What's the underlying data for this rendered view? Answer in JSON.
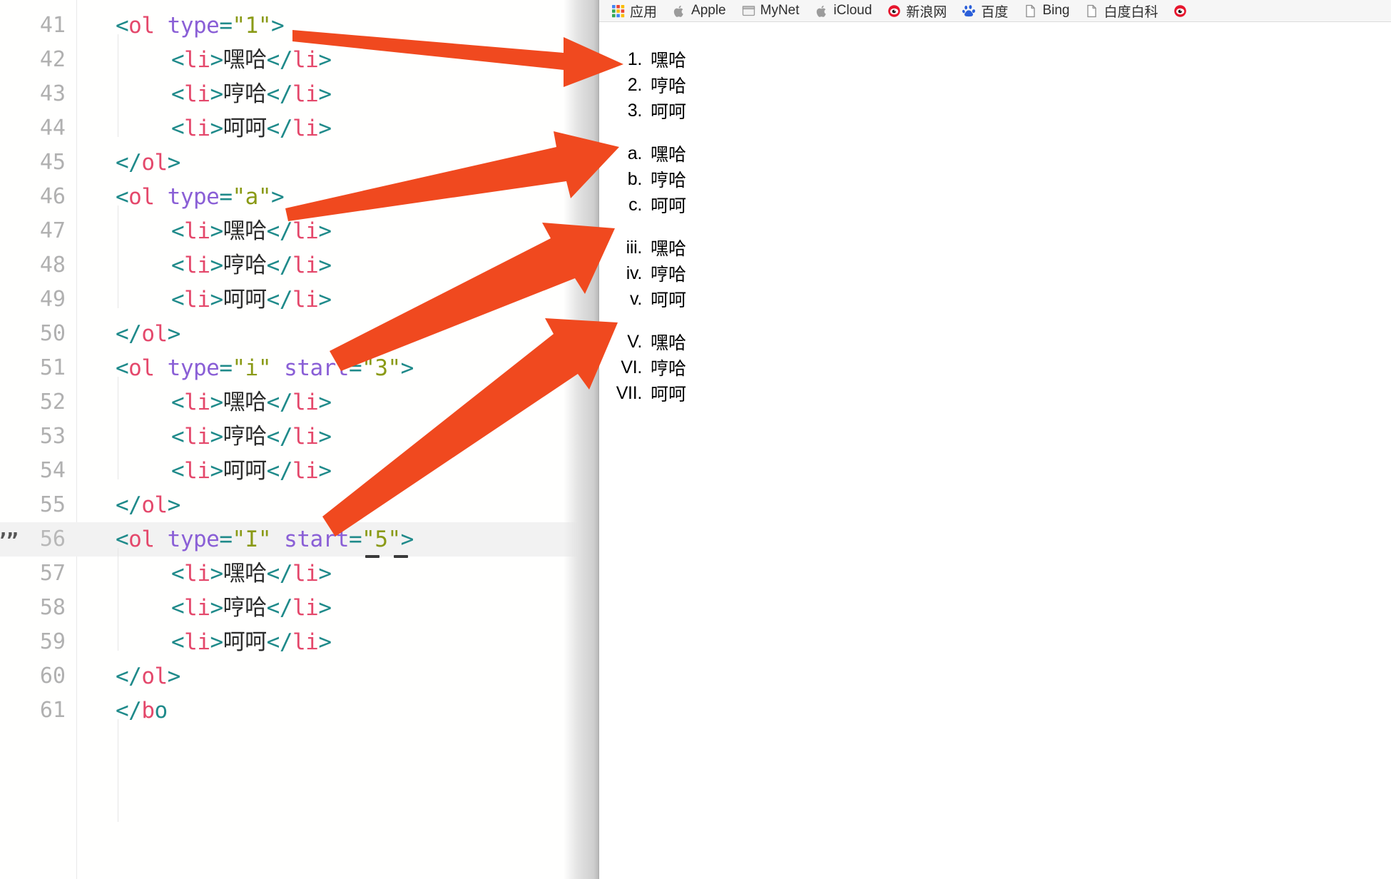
{
  "editor": {
    "language": "html",
    "first_line": 41,
    "highlighted_line": 56,
    "highlight_marker": "””",
    "lines": [
      {
        "n": "41",
        "indent": 1,
        "tokens": [
          {
            "t": "br",
            "v": "<"
          },
          {
            "t": "tag",
            "v": "ol"
          },
          {
            "t": "txt",
            "v": " "
          },
          {
            "t": "attr",
            "v": "type"
          },
          {
            "t": "eq",
            "v": "="
          },
          {
            "t": "str",
            "v": "\"1\""
          },
          {
            "t": "br",
            "v": ">"
          }
        ]
      },
      {
        "n": "42",
        "indent": 2,
        "tokens": [
          {
            "t": "br",
            "v": "<"
          },
          {
            "t": "tag",
            "v": "li"
          },
          {
            "t": "br",
            "v": ">"
          },
          {
            "t": "txt",
            "v": "嘿哈"
          },
          {
            "t": "br",
            "v": "</"
          },
          {
            "t": "tag",
            "v": "li"
          },
          {
            "t": "br",
            "v": ">"
          }
        ]
      },
      {
        "n": "43",
        "indent": 2,
        "tokens": [
          {
            "t": "br",
            "v": "<"
          },
          {
            "t": "tag",
            "v": "li"
          },
          {
            "t": "br",
            "v": ">"
          },
          {
            "t": "txt",
            "v": "哼哈"
          },
          {
            "t": "br",
            "v": "</"
          },
          {
            "t": "tag",
            "v": "li"
          },
          {
            "t": "br",
            "v": ">"
          }
        ]
      },
      {
        "n": "44",
        "indent": 2,
        "tokens": [
          {
            "t": "br",
            "v": "<"
          },
          {
            "t": "tag",
            "v": "li"
          },
          {
            "t": "br",
            "v": ">"
          },
          {
            "t": "txt",
            "v": "呵呵"
          },
          {
            "t": "br",
            "v": "</"
          },
          {
            "t": "tag",
            "v": "li"
          },
          {
            "t": "br",
            "v": ">"
          }
        ]
      },
      {
        "n": "45",
        "indent": 1,
        "tokens": [
          {
            "t": "br",
            "v": "</"
          },
          {
            "t": "tag",
            "v": "ol"
          },
          {
            "t": "br",
            "v": ">"
          }
        ]
      },
      {
        "n": "46",
        "indent": 1,
        "tokens": [
          {
            "t": "br",
            "v": "<"
          },
          {
            "t": "tag",
            "v": "ol"
          },
          {
            "t": "txt",
            "v": " "
          },
          {
            "t": "attr",
            "v": "type"
          },
          {
            "t": "eq",
            "v": "="
          },
          {
            "t": "str",
            "v": "\"a\""
          },
          {
            "t": "br",
            "v": ">"
          }
        ]
      },
      {
        "n": "47",
        "indent": 2,
        "tokens": [
          {
            "t": "br",
            "v": "<"
          },
          {
            "t": "tag",
            "v": "li"
          },
          {
            "t": "br",
            "v": ">"
          },
          {
            "t": "txt",
            "v": "嘿哈"
          },
          {
            "t": "br",
            "v": "</"
          },
          {
            "t": "tag",
            "v": "li"
          },
          {
            "t": "br",
            "v": ">"
          }
        ]
      },
      {
        "n": "48",
        "indent": 2,
        "tokens": [
          {
            "t": "br",
            "v": "<"
          },
          {
            "t": "tag",
            "v": "li"
          },
          {
            "t": "br",
            "v": ">"
          },
          {
            "t": "txt",
            "v": "哼哈"
          },
          {
            "t": "br",
            "v": "</"
          },
          {
            "t": "tag",
            "v": "li"
          },
          {
            "t": "br",
            "v": ">"
          }
        ]
      },
      {
        "n": "49",
        "indent": 2,
        "tokens": [
          {
            "t": "br",
            "v": "<"
          },
          {
            "t": "tag",
            "v": "li"
          },
          {
            "t": "br",
            "v": ">"
          },
          {
            "t": "txt",
            "v": "呵呵"
          },
          {
            "t": "br",
            "v": "</"
          },
          {
            "t": "tag",
            "v": "li"
          },
          {
            "t": "br",
            "v": ">"
          }
        ]
      },
      {
        "n": "50",
        "indent": 1,
        "tokens": [
          {
            "t": "br",
            "v": "</"
          },
          {
            "t": "tag",
            "v": "ol"
          },
          {
            "t": "br",
            "v": ">"
          }
        ]
      },
      {
        "n": "51",
        "indent": 1,
        "tokens": [
          {
            "t": "br",
            "v": "<"
          },
          {
            "t": "tag",
            "v": "ol"
          },
          {
            "t": "txt",
            "v": " "
          },
          {
            "t": "attr",
            "v": "type"
          },
          {
            "t": "eq",
            "v": "="
          },
          {
            "t": "str",
            "v": "\"i\""
          },
          {
            "t": "txt",
            "v": " "
          },
          {
            "t": "attr",
            "v": "start"
          },
          {
            "t": "eq",
            "v": "="
          },
          {
            "t": "str",
            "v": "\"3\""
          },
          {
            "t": "br",
            "v": ">"
          }
        ]
      },
      {
        "n": "52",
        "indent": 2,
        "tokens": [
          {
            "t": "br",
            "v": "<"
          },
          {
            "t": "tag",
            "v": "li"
          },
          {
            "t": "br",
            "v": ">"
          },
          {
            "t": "txt",
            "v": "嘿哈"
          },
          {
            "t": "br",
            "v": "</"
          },
          {
            "t": "tag",
            "v": "li"
          },
          {
            "t": "br",
            "v": ">"
          }
        ]
      },
      {
        "n": "53",
        "indent": 2,
        "tokens": [
          {
            "t": "br",
            "v": "<"
          },
          {
            "t": "tag",
            "v": "li"
          },
          {
            "t": "br",
            "v": ">"
          },
          {
            "t": "txt",
            "v": "哼哈"
          },
          {
            "t": "br",
            "v": "</"
          },
          {
            "t": "tag",
            "v": "li"
          },
          {
            "t": "br",
            "v": ">"
          }
        ]
      },
      {
        "n": "54",
        "indent": 2,
        "tokens": [
          {
            "t": "br",
            "v": "<"
          },
          {
            "t": "tag",
            "v": "li"
          },
          {
            "t": "br",
            "v": ">"
          },
          {
            "t": "txt",
            "v": "呵呵"
          },
          {
            "t": "br",
            "v": "</"
          },
          {
            "t": "tag",
            "v": "li"
          },
          {
            "t": "br",
            "v": ">"
          }
        ]
      },
      {
        "n": "55",
        "indent": 1,
        "tokens": [
          {
            "t": "br",
            "v": "</"
          },
          {
            "t": "tag",
            "v": "ol"
          },
          {
            "t": "br",
            "v": ">"
          }
        ]
      },
      {
        "n": "56",
        "indent": 1,
        "tokens": [
          {
            "t": "br",
            "v": "<"
          },
          {
            "t": "tag",
            "v": "ol"
          },
          {
            "t": "txt",
            "v": " "
          },
          {
            "t": "attr",
            "v": "type"
          },
          {
            "t": "eq",
            "v": "="
          },
          {
            "t": "str",
            "v": "\"I\""
          },
          {
            "t": "txt",
            "v": " "
          },
          {
            "t": "attr",
            "v": "start"
          },
          {
            "t": "eq",
            "v": "="
          },
          {
            "t": "str",
            "v": "\"5\""
          },
          {
            "t": "br",
            "v": ">"
          }
        ]
      },
      {
        "n": "57",
        "indent": 2,
        "tokens": [
          {
            "t": "br",
            "v": "<"
          },
          {
            "t": "tag",
            "v": "li"
          },
          {
            "t": "br",
            "v": ">"
          },
          {
            "t": "txt",
            "v": "嘿哈"
          },
          {
            "t": "br",
            "v": "</"
          },
          {
            "t": "tag",
            "v": "li"
          },
          {
            "t": "br",
            "v": ">"
          }
        ]
      },
      {
        "n": "58",
        "indent": 2,
        "tokens": [
          {
            "t": "br",
            "v": "<"
          },
          {
            "t": "tag",
            "v": "li"
          },
          {
            "t": "br",
            "v": ">"
          },
          {
            "t": "txt",
            "v": "哼哈"
          },
          {
            "t": "br",
            "v": "</"
          },
          {
            "t": "tag",
            "v": "li"
          },
          {
            "t": "br",
            "v": ">"
          }
        ]
      },
      {
        "n": "59",
        "indent": 2,
        "tokens": [
          {
            "t": "br",
            "v": "<"
          },
          {
            "t": "tag",
            "v": "li"
          },
          {
            "t": "br",
            "v": ">"
          },
          {
            "t": "txt",
            "v": "呵呵"
          },
          {
            "t": "br",
            "v": "</"
          },
          {
            "t": "tag",
            "v": "li"
          },
          {
            "t": "br",
            "v": ">"
          }
        ]
      },
      {
        "n": "60",
        "indent": 1,
        "tokens": [
          {
            "t": "br",
            "v": "</"
          },
          {
            "t": "tag",
            "v": "ol"
          },
          {
            "t": "br",
            "v": ">"
          }
        ]
      },
      {
        "n": "61",
        "indent": 1,
        "tokens": [
          {
            "t": "br",
            "v": "</"
          },
          {
            "t": "tag",
            "v": "b"
          },
          {
            "t": "br",
            "v": "o"
          }
        ]
      }
    ],
    "colors": {
      "bracket": "#1f8a8a",
      "tag": "#e4486b",
      "attribute": "#8a5fd6",
      "string": "#8a9a16",
      "text": "#2b2b2b",
      "line_number": "#b0b0b0",
      "highlight_bg": "#f2f2f2"
    }
  },
  "browser": {
    "bookmarks": [
      {
        "label": "应用",
        "icon": "apps-grid-icon"
      },
      {
        "label": "Apple",
        "icon": "apple-icon"
      },
      {
        "label": "MyNet",
        "icon": "window-icon"
      },
      {
        "label": "iCloud",
        "icon": "apple-icon"
      },
      {
        "label": "新浪网",
        "icon": "weibo-icon"
      },
      {
        "label": "百度",
        "icon": "baidu-icon"
      },
      {
        "label": "Bing",
        "icon": "page-icon"
      },
      {
        "label": "白度白科",
        "icon": "page-icon"
      },
      {
        "label": "",
        "icon": "weibo-icon"
      }
    ],
    "rendered_lists": [
      {
        "name": "decimal-list",
        "type": "1",
        "start": 1,
        "items": [
          {
            "marker": "1.",
            "text": "嘿哈"
          },
          {
            "marker": "2.",
            "text": "哼哈"
          },
          {
            "marker": "3.",
            "text": "呵呵"
          }
        ]
      },
      {
        "name": "lower-alpha-list",
        "type": "a",
        "start": 1,
        "items": [
          {
            "marker": "a.",
            "text": "嘿哈"
          },
          {
            "marker": "b.",
            "text": "哼哈"
          },
          {
            "marker": "c.",
            "text": "呵呵"
          }
        ]
      },
      {
        "name": "lower-roman-list",
        "type": "i",
        "start": 3,
        "items": [
          {
            "marker": "iii.",
            "text": "嘿哈"
          },
          {
            "marker": "iv.",
            "text": "哼哈"
          },
          {
            "marker": "v.",
            "text": "呵呵"
          }
        ]
      },
      {
        "name": "upper-roman-list",
        "type": "I",
        "start": 5,
        "items": [
          {
            "marker": "V.",
            "text": "嘿哈"
          },
          {
            "marker": "VI.",
            "text": "哼哈"
          },
          {
            "marker": "VII.",
            "text": "呵呵"
          }
        ]
      }
    ]
  },
  "annotations": {
    "color": "#f0491f",
    "arrows": [
      {
        "name": "arrow-to-decimal-list",
        "from_line": 41,
        "to_list": "decimal-list"
      },
      {
        "name": "arrow-to-lower-alpha-list",
        "from_line": 46,
        "to_list": "lower-alpha-list"
      },
      {
        "name": "arrow-to-lower-roman-list",
        "from_line": 51,
        "to_list": "lower-roman-list"
      },
      {
        "name": "arrow-to-upper-roman-list",
        "from_line": 56,
        "to_list": "upper-roman-list"
      }
    ],
    "underlines": [
      {
        "name": "underline-start-attr-mark-1"
      },
      {
        "name": "underline-start-attr-mark-2"
      }
    ]
  }
}
